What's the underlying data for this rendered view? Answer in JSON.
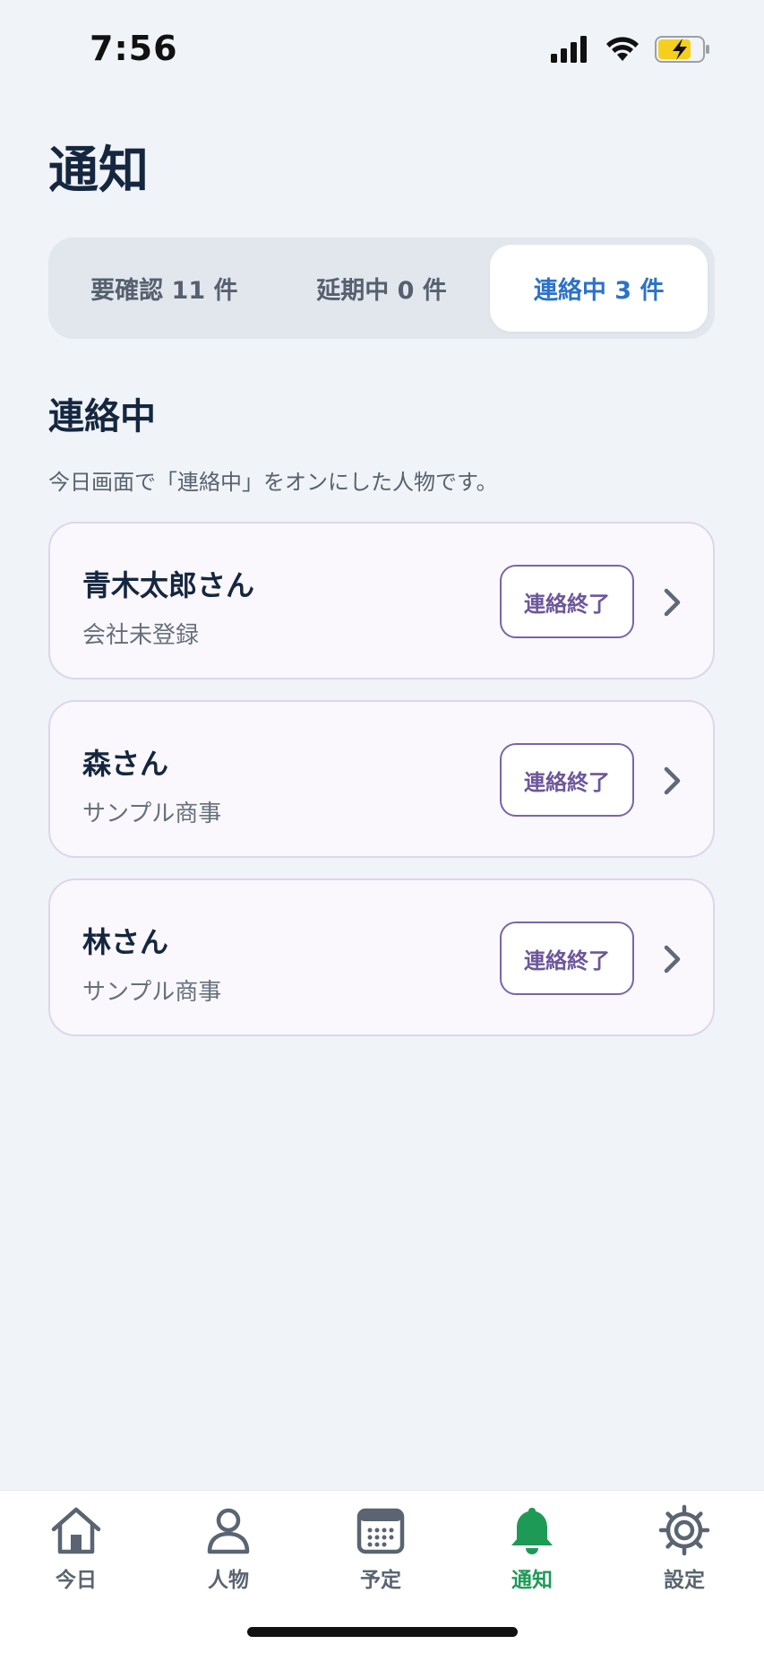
{
  "status_bar": {
    "time": "7:56"
  },
  "page": {
    "title": "通知"
  },
  "segments": [
    {
      "label": "要確認 11 件",
      "active": false
    },
    {
      "label": "延期中 0 件",
      "active": false
    },
    {
      "label": "連絡中 3 件",
      "active": true
    }
  ],
  "section": {
    "title": "連絡中",
    "description": "今日画面で「連絡中」をオンにした人物です。"
  },
  "contacts": [
    {
      "name": "青木太郎さん",
      "company": "会社未登録",
      "action_label": "連絡終了"
    },
    {
      "name": "森さん",
      "company": "サンプル商事",
      "action_label": "連絡終了"
    },
    {
      "name": "林さん",
      "company": "サンプル商事",
      "action_label": "連絡終了"
    }
  ],
  "tab_bar": {
    "items": [
      {
        "label": "今日",
        "icon": "home-icon"
      },
      {
        "label": "人物",
        "icon": "person-icon"
      },
      {
        "label": "予定",
        "icon": "calendar-icon"
      },
      {
        "label": "通知",
        "icon": "bell-icon",
        "active": true
      },
      {
        "label": "設定",
        "icon": "gear-icon"
      }
    ]
  },
  "colors": {
    "background": "#f0f3f7",
    "accent_blue": "#2c72c8",
    "accent_purple": "#6d569c",
    "active_tab_green": "#1e9a57",
    "battery_yellow": "#f5cf1d"
  }
}
